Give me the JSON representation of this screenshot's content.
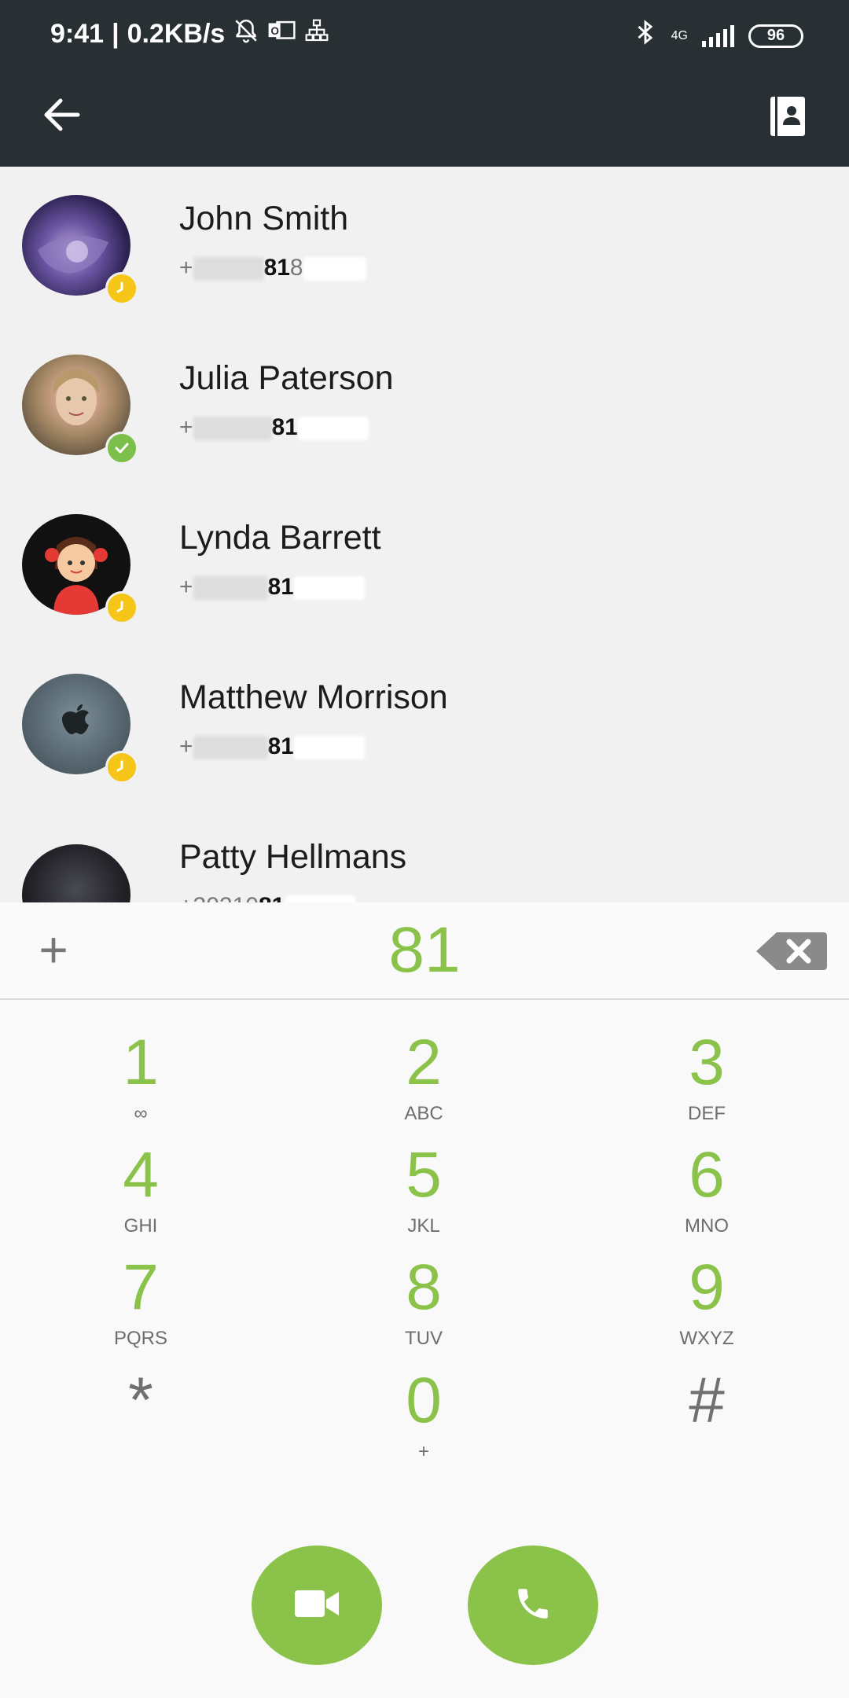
{
  "status_bar": {
    "time": "9:41",
    "speed": "0.2KB/s",
    "network": "4G",
    "battery": "96",
    "icons": [
      "mute-bell-icon",
      "outlook-icon",
      "network-tree-icon",
      "bluetooth-icon",
      "signal-icon",
      "battery-icon"
    ]
  },
  "app_bar": {
    "back_icon": "arrow-left-icon",
    "contacts_icon": "contacts-book-icon"
  },
  "contacts": [
    {
      "name": "John Smith",
      "number_prefix": "+",
      "number_match": "81",
      "number_suffix": "8",
      "status": "away",
      "avatar": "robot"
    },
    {
      "name": "Julia Paterson",
      "number_prefix": "+",
      "number_match": "81",
      "number_suffix": "",
      "status": "online",
      "avatar": "woman"
    },
    {
      "name": "Lynda Barrett",
      "number_prefix": "+",
      "number_match": "81",
      "number_suffix": "",
      "status": "away",
      "avatar": "girl"
    },
    {
      "name": "Matthew Morrison",
      "number_prefix": "+",
      "number_match": "81",
      "number_suffix": "",
      "status": "away",
      "avatar": "apple"
    },
    {
      "name": "Patty Hellmans",
      "number_prefix": "+30210",
      "number_match": "81",
      "number_suffix": "",
      "status": "none",
      "avatar": "dark"
    }
  ],
  "dialer": {
    "plus_label": "+",
    "value": "81"
  },
  "keypad": [
    {
      "digit": "1",
      "letters": "∞"
    },
    {
      "digit": "2",
      "letters": "ABC"
    },
    {
      "digit": "3",
      "letters": "DEF"
    },
    {
      "digit": "4",
      "letters": "GHI"
    },
    {
      "digit": "5",
      "letters": "JKL"
    },
    {
      "digit": "6",
      "letters": "MNO"
    },
    {
      "digit": "7",
      "letters": "PQRS"
    },
    {
      "digit": "8",
      "letters": "TUV"
    },
    {
      "digit": "9",
      "letters": "WXYZ"
    },
    {
      "digit": "*",
      "letters": ""
    },
    {
      "digit": "0",
      "letters": "+"
    },
    {
      "digit": "#",
      "letters": ""
    }
  ],
  "actions": {
    "video_call_icon": "video-camera-icon",
    "voice_call_icon": "phone-icon"
  },
  "colors": {
    "accent": "#8bc34a",
    "bar": "#293033",
    "away": "#f5c518",
    "online": "#7cc04b"
  }
}
